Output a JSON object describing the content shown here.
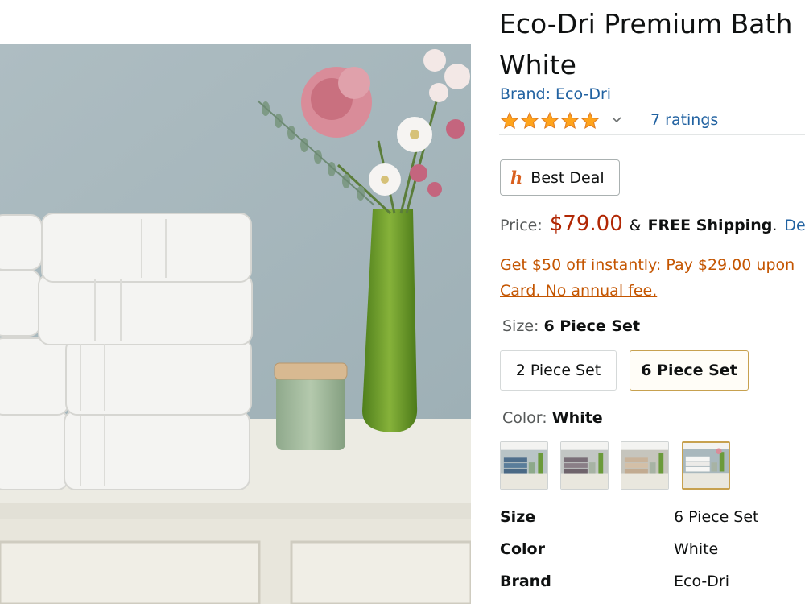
{
  "product": {
    "title_line1": "Eco-Dri Premium Bath",
    "title_line2": "White",
    "brand_text": "Brand: Eco-Dri",
    "rating_stars": 5,
    "ratings_text": "7 ratings"
  },
  "deal": {
    "icon_glyph": "h",
    "label": "Best Deal"
  },
  "price": {
    "label": "Price:",
    "value": "$79.00",
    "amp": "&",
    "shipping": "FREE Shipping",
    "dot": ".",
    "details": "Det"
  },
  "promo": {
    "line1": "Get $50 off instantly: Pay $29.00 upon",
    "line2": "Card. No annual fee."
  },
  "size_selector": {
    "label": "Size: ",
    "selected": "6 Piece Set",
    "options": [
      "2 Piece Set",
      "6 Piece Set"
    ]
  },
  "color_selector": {
    "label": "Color: ",
    "selected": "White",
    "swatches": [
      "blue-towels",
      "gray-towels",
      "beige-towels",
      "white-towels"
    ]
  },
  "specs": [
    {
      "key": "Size",
      "value": "6 Piece Set"
    },
    {
      "key": "Color",
      "value": "White"
    },
    {
      "key": "Brand",
      "value": "Eco-Dri"
    }
  ],
  "colors": {
    "link": "#2162a1",
    "price": "#b12704",
    "promo": "#c45500",
    "star": "#ffa41c",
    "selected_border": "#c7a14f"
  }
}
